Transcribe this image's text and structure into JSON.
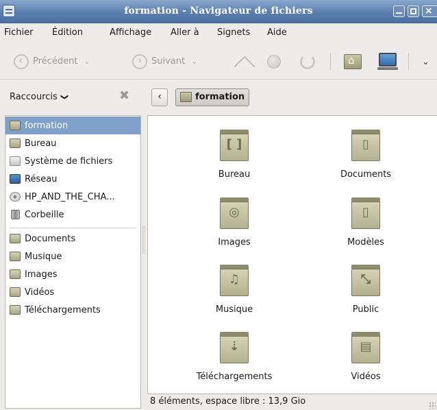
{
  "window": {
    "title": "formation - Navigateur de fichiers"
  },
  "menu": {
    "items": [
      "Fichier",
      "Édition",
      "Affichage",
      "Aller à",
      "Signets",
      "Aide"
    ]
  },
  "toolbar": {
    "back_label": "Précédent",
    "forward_label": "Suivant",
    "dropdown_caret": "⌄",
    "more": "❯"
  },
  "sidebar": {
    "header_label": "Raccourcis",
    "header_caret": "❯",
    "close_glyph": "✖",
    "items": [
      {
        "label": "formation",
        "icon": "home-folder-icon"
      },
      {
        "label": "Bureau",
        "icon": "desktop-folder-icon"
      },
      {
        "label": "Système de fichiers",
        "icon": "filesystem-icon"
      },
      {
        "label": "Réseau",
        "icon": "network-icon"
      },
      {
        "label": "HP_AND_THE_CHA...",
        "icon": "optical-disc-icon"
      },
      {
        "label": "Corbeille",
        "icon": "trash-icon"
      },
      {
        "label": "Documents",
        "icon": "documents-folder-icon"
      },
      {
        "label": "Musique",
        "icon": "music-folder-icon"
      },
      {
        "label": "Images",
        "icon": "pictures-folder-icon"
      },
      {
        "label": "Vidéos",
        "icon": "videos-folder-icon"
      },
      {
        "label": "Téléchargements",
        "icon": "downloads-folder-icon"
      }
    ],
    "selected_index": 0
  },
  "location": {
    "back_glyph": "‹",
    "current_folder": "formation"
  },
  "content": {
    "folders": [
      {
        "label": "Bureau",
        "emblem": "[ ]"
      },
      {
        "label": "Documents",
        "emblem": "▯"
      },
      {
        "label": "Images",
        "emblem": "◎"
      },
      {
        "label": "Modèles",
        "emblem": "▯"
      },
      {
        "label": "Musique",
        "emblem": "♫"
      },
      {
        "label": "Public",
        "emblem": "⤡"
      },
      {
        "label": "Téléchargements",
        "emblem": "⇣"
      },
      {
        "label": "Vidéos",
        "emblem": "▤"
      }
    ]
  },
  "status": {
    "text": "8 éléments, espace libre : 13,9 Gio"
  },
  "colors": {
    "titlebar": "#5a7fae",
    "selection": "#7fa0c8",
    "folder": "#c4c2a2"
  }
}
